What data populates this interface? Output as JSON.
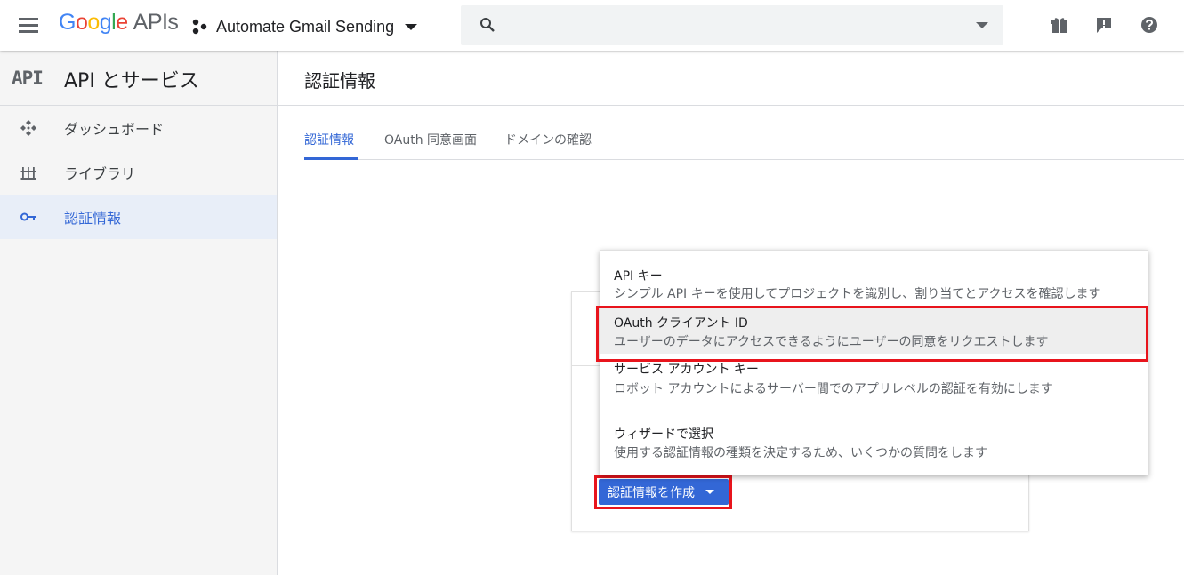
{
  "header": {
    "logo_google": [
      "G",
      "o",
      "o",
      "g",
      "l",
      "e"
    ],
    "logo_apis": "APIs",
    "project_name": "Automate Gmail Sending",
    "search_placeholder": ""
  },
  "sidebar": {
    "api_icon_text": "API",
    "title": "API とサービス",
    "items": [
      {
        "label": "ダッシュボード",
        "icon": "dashboard-icon",
        "active": false
      },
      {
        "label": "ライブラリ",
        "icon": "library-icon",
        "active": false
      },
      {
        "label": "認証情報",
        "icon": "key-icon",
        "active": true
      }
    ]
  },
  "main": {
    "page_title": "認証情報",
    "tabs": [
      {
        "label": "認証情報",
        "active": true
      },
      {
        "label": "OAuth 同意画面",
        "active": false
      },
      {
        "label": "ドメインの確認",
        "active": false
      }
    ],
    "create_button_label": "認証情報を作成"
  },
  "dropdown": {
    "items": [
      {
        "title": "API キー",
        "description": "シンプル API キーを使用してプロジェクトを識別し、割り当てとアクセスを確認します"
      },
      {
        "title": "OAuth クライアント ID",
        "description": "ユーザーのデータにアクセスできるようにユーザーの同意をリクエストします",
        "highlighted": true
      },
      {
        "title": "サービス アカウント キー",
        "description": "ロボット アカウントによるサーバー間でのアプリレベルの認証を有効にします"
      },
      {
        "title": "ウィザードで選択",
        "description": "使用する認証情報の種類を決定するため、いくつかの質問をします"
      }
    ]
  },
  "colors": {
    "accent": "#3367d6",
    "highlight_border": "#e8141c",
    "sidebar_bg": "#f5f5f5",
    "active_item_bg": "#e8eef8"
  }
}
